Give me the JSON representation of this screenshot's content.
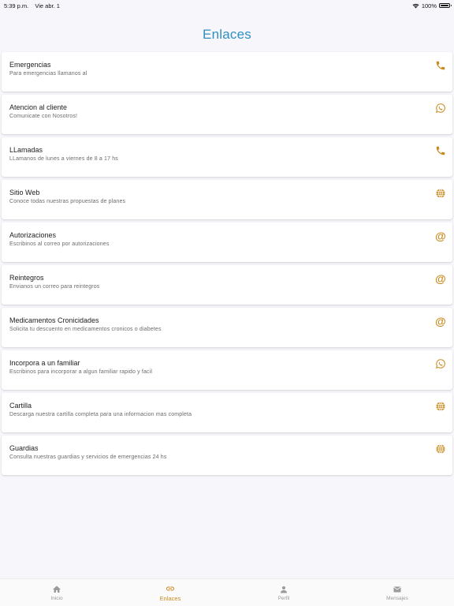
{
  "status": {
    "time": "5:39 p.m.",
    "date": "Vie abr. 1",
    "battery": "100%"
  },
  "title": "Enlaces",
  "items": [
    {
      "title": "Emergencias",
      "subtitle": "Para emergencias llamanos al",
      "icon": "phone-icon"
    },
    {
      "title": "Atencion al cliente",
      "subtitle": "Comunicate con Nosotros!",
      "icon": "whatsapp-icon"
    },
    {
      "title": "LLamadas",
      "subtitle": "LLamanos de lunes a viernes de 8 a 17 hs",
      "icon": "phone-icon"
    },
    {
      "title": "Sitio Web",
      "subtitle": "Conoce todas nuestras propuestas de planes",
      "icon": "globe-icon"
    },
    {
      "title": "Autorizaciones",
      "subtitle": "Escribinos al correo por autorizaciones",
      "icon": "at-icon"
    },
    {
      "title": "Reintegros",
      "subtitle": "Envianos un correo para reintegros",
      "icon": "at-icon"
    },
    {
      "title": "Medicamentos Cronicidades",
      "subtitle": "Solicita tu descuento en medicamentos cronicos o diabetes",
      "icon": "at-icon"
    },
    {
      "title": "Incorpora a un familiar",
      "subtitle": "Escribinos para incorporar a algun familiar rapido y facil",
      "icon": "whatsapp-icon"
    },
    {
      "title": "Cartilla",
      "subtitle": "Descarga nuestra cartilla completa para una informacion mas completa",
      "icon": "globe-icon"
    },
    {
      "title": "Guardias",
      "subtitle": "Consulta nuestras guardias y servicios de emergencias 24 hs",
      "icon": "globe-icon"
    }
  ],
  "tabs": [
    {
      "label": "Inicio",
      "icon": "home-icon"
    },
    {
      "label": "Enlaces",
      "icon": "link-icon"
    },
    {
      "label": "Perfil",
      "icon": "person-icon"
    },
    {
      "label": "Mensajes",
      "icon": "mail-icon"
    }
  ],
  "colors": {
    "accent": "#c98b1f",
    "title": "#2f8fc3",
    "inactive": "#9a9a9a"
  }
}
